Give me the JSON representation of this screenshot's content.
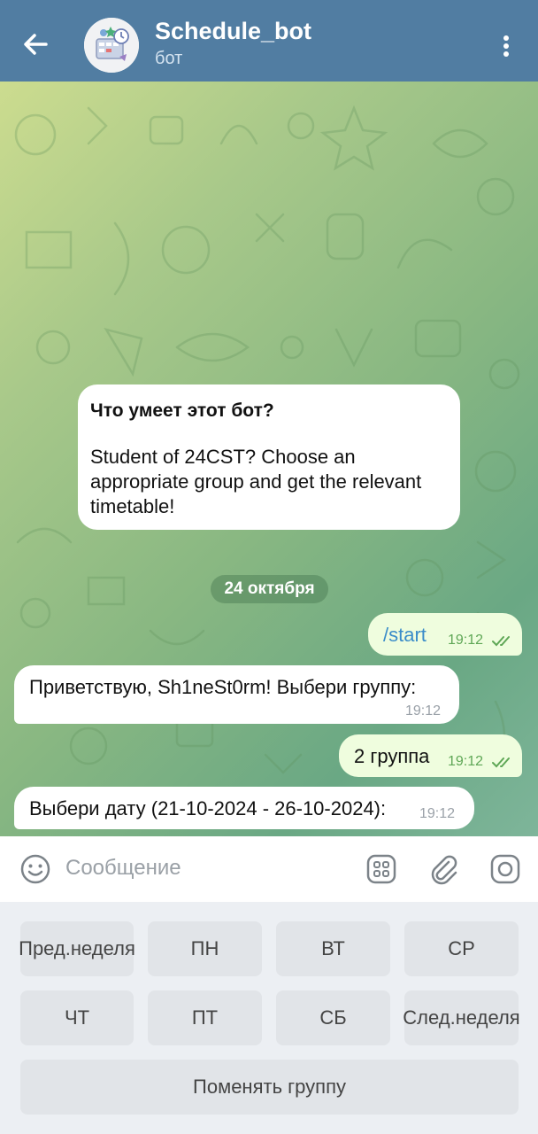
{
  "header": {
    "title": "Schedule_bot",
    "subtitle": "бот"
  },
  "chat": {
    "bot_info": {
      "title": "Что умеет этот бот?",
      "text": "Student of 24CST? Choose an appropriate group and get the relevant timetable!"
    },
    "date_separator": "24 октября",
    "messages": [
      {
        "direction": "outgoing",
        "text": "/start",
        "time": "19:12",
        "read": true
      },
      {
        "direction": "incoming",
        "text": "Приветствую, Sh1neSt0rm! Выбери группу:",
        "time": "19:12"
      },
      {
        "direction": "outgoing",
        "text": "2 группа",
        "time": "19:12",
        "read": true
      },
      {
        "direction": "incoming",
        "text": "Выбери дату (21-10-2024 - 26-10-2024):",
        "time": "19:12"
      }
    ]
  },
  "input": {
    "placeholder": "Сообщение"
  },
  "keyboard": {
    "rows": [
      [
        "Пред.неделя",
        "ПН",
        "ВТ",
        "СР"
      ],
      [
        "ЧТ",
        "ПТ",
        "СБ",
        "След.неделя"
      ],
      [
        "Поменять группу"
      ]
    ]
  },
  "colors": {
    "header_bg": "#517da2",
    "outgoing_bubble": "#effdde",
    "incoming_bubble": "#ffffff",
    "link": "#3a8cc9",
    "read_ticks": "#5fa756"
  }
}
